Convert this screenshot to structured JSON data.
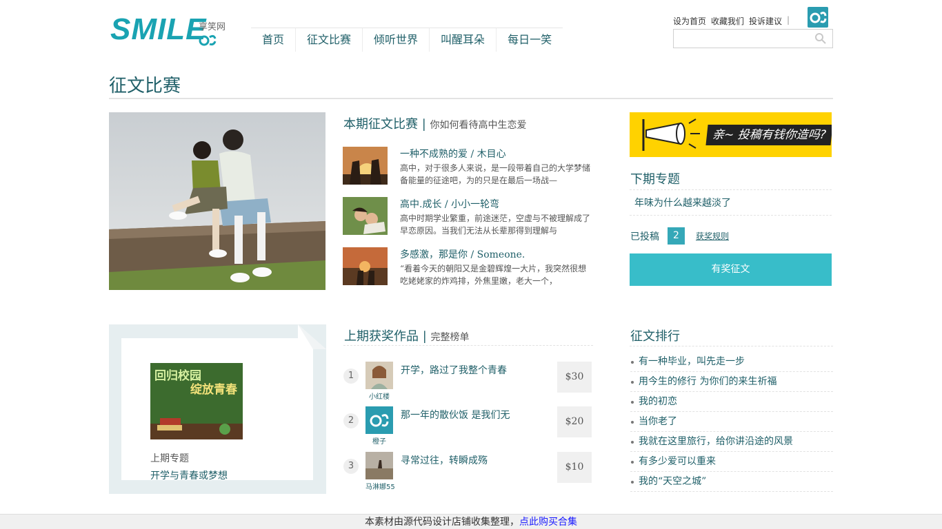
{
  "header": {
    "logo_text": "SMILE",
    "logo_tagline": "享笑网",
    "nav": [
      "首页",
      "征文比赛",
      "倾听世界",
      "叫醒耳朵",
      "每日一笑"
    ],
    "top_links": [
      "设为首页",
      "收藏我们",
      "投诉建议"
    ],
    "top_sep": "|",
    "search": {
      "placeholder": "",
      "value": ""
    }
  },
  "page": {
    "title": "征文比赛"
  },
  "current_contest": {
    "heading": "本期征文比赛",
    "separator": "|",
    "topic": "你如何看待高中生恋爱",
    "entries": [
      {
        "title": "一种不成熟的爱 / 木目心",
        "desc": "高中，对于很多人来说，是一段带着自己的大学梦储备能量的征途吧，为的只是在最后一场战—"
      },
      {
        "title": "高中.成长 / 小小一轮弯",
        "desc": "高中时期学业繁重，前途迷茫，空虚与不被理解成了早恋原因。当我们无法从长辈那得到理解与"
      },
      {
        "title": "多感激，那是你 / Someone.",
        "desc": "“看着今天的朝阳又是金碧辉煌一大片，我突然很想吃姥姥家的炸鸡排，外焦里嫩，老大一个，"
      }
    ]
  },
  "sidebar": {
    "banner_text": "亲~ 投稿有钱你造吗?",
    "next_heading": "下期专题",
    "next_topic": "年味为什么越来越淡了",
    "submitted_label": "已投稿",
    "submitted_count": "2",
    "rules_link": "获奖规则",
    "submit_button": "有奖征文"
  },
  "previous": {
    "image_line1": "回归校园",
    "image_line2": "绽放青春",
    "label": "上期专题",
    "topic": "开学与青春或梦想"
  },
  "winners": {
    "heading": "上期获奖作品",
    "separator": "|",
    "full_list": "完整榜单",
    "items": [
      {
        "rank": "1",
        "title": "开学，路过了我整个青春",
        "user": "小红楼",
        "prize": "$30"
      },
      {
        "rank": "2",
        "title": "那一年的散伙饭 是我们无",
        "user": "橙子",
        "prize": "$20"
      },
      {
        "rank": "3",
        "title": "寻常过往，转瞬成殇",
        "user": "马淋娜55",
        "prize": "$10"
      }
    ]
  },
  "ranking": {
    "heading": "征文排行",
    "items": [
      "有一种毕业，叫先走一步",
      "用今生的修行 为你们的来生祈福",
      "我的初恋",
      "当你老了",
      "我就在这里旅行，给你讲沿途的风景",
      "有多少爱可以重来",
      "我的“天空之城”"
    ]
  },
  "footer": {
    "text": "本素材由源代码设计店铺收集整理，",
    "link": "点此购买合集"
  },
  "colors": {
    "accent": "#1f5f68",
    "button": "#38bdc9",
    "banner": "#ffd200"
  }
}
